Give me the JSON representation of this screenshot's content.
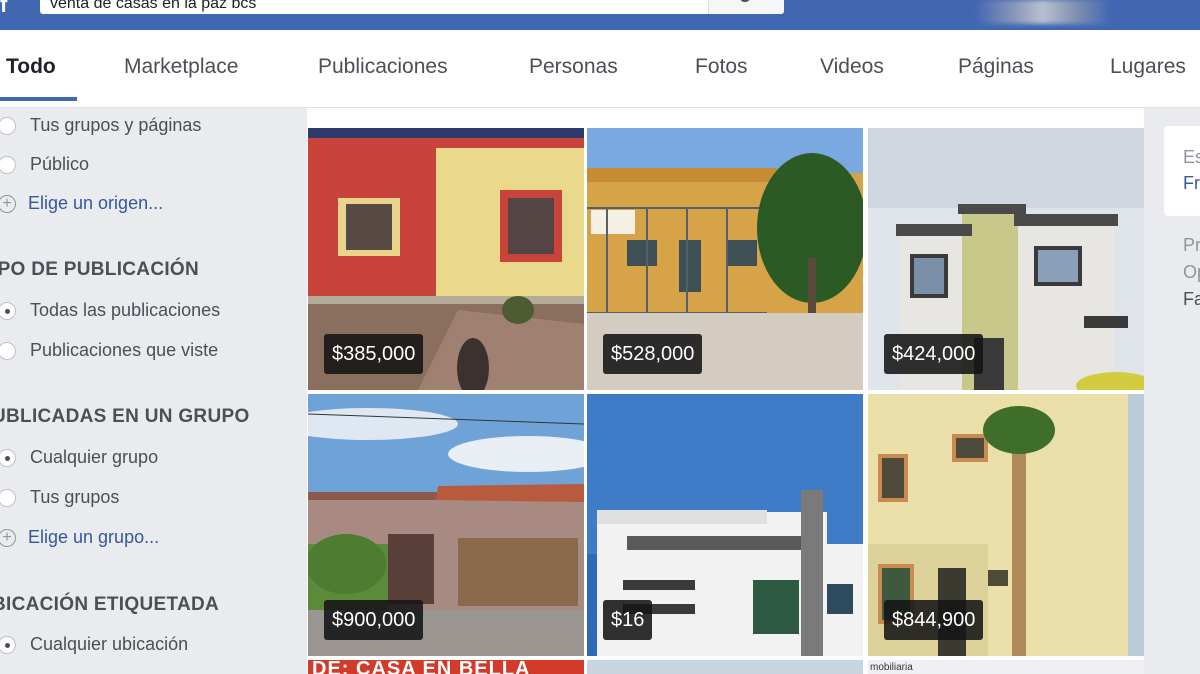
{
  "search": {
    "value": "venta de casas en la paz bcs"
  },
  "tabs": [
    {
      "label": "Todo"
    },
    {
      "label": "Marketplace"
    },
    {
      "label": "Publicaciones"
    },
    {
      "label": "Personas"
    },
    {
      "label": "Fotos"
    },
    {
      "label": "Videos"
    },
    {
      "label": "Páginas"
    },
    {
      "label": "Lugares"
    }
  ],
  "sidebar": {
    "source_options": [
      {
        "label": "Tus grupos y páginas",
        "selected": false
      },
      {
        "label": "Público",
        "selected": false
      },
      {
        "label": "Elige un origen..."
      }
    ],
    "post_type": {
      "heading": "IPO DE PUBLICACIÓN",
      "options": [
        {
          "label": "Todas las publicaciones",
          "selected": true
        },
        {
          "label": "Publicaciones que viste",
          "selected": false
        }
      ]
    },
    "group": {
      "heading": "UBLICADAS EN UN GRUPO",
      "options": [
        {
          "label": "Cualquier grupo",
          "selected": true
        },
        {
          "label": "Tus grupos",
          "selected": false
        },
        {
          "label": "Elige un grupo..."
        }
      ]
    },
    "location": {
      "heading": "BICACIÓN ETIQUETADA",
      "options": [
        {
          "label": "Cualquier ubicación",
          "selected": true
        }
      ]
    }
  },
  "listings": [
    {
      "price": "$385,000"
    },
    {
      "price": "$528,000"
    },
    {
      "price": "$424,000"
    },
    {
      "price": "$900,000"
    },
    {
      "price": "$16"
    },
    {
      "price": "$844,900"
    }
  ],
  "partial_banner": "DE: CASA EN BELLA",
  "partial_caption": "mobiliaria",
  "right_panel": {
    "card_line1": "Es",
    "card_line2": "Fr",
    "line3": "Pr",
    "line4": "Op",
    "line5": "Fa"
  },
  "colors": {
    "brand": "#4267b2",
    "link": "#365899",
    "background": "#e9ebee"
  }
}
